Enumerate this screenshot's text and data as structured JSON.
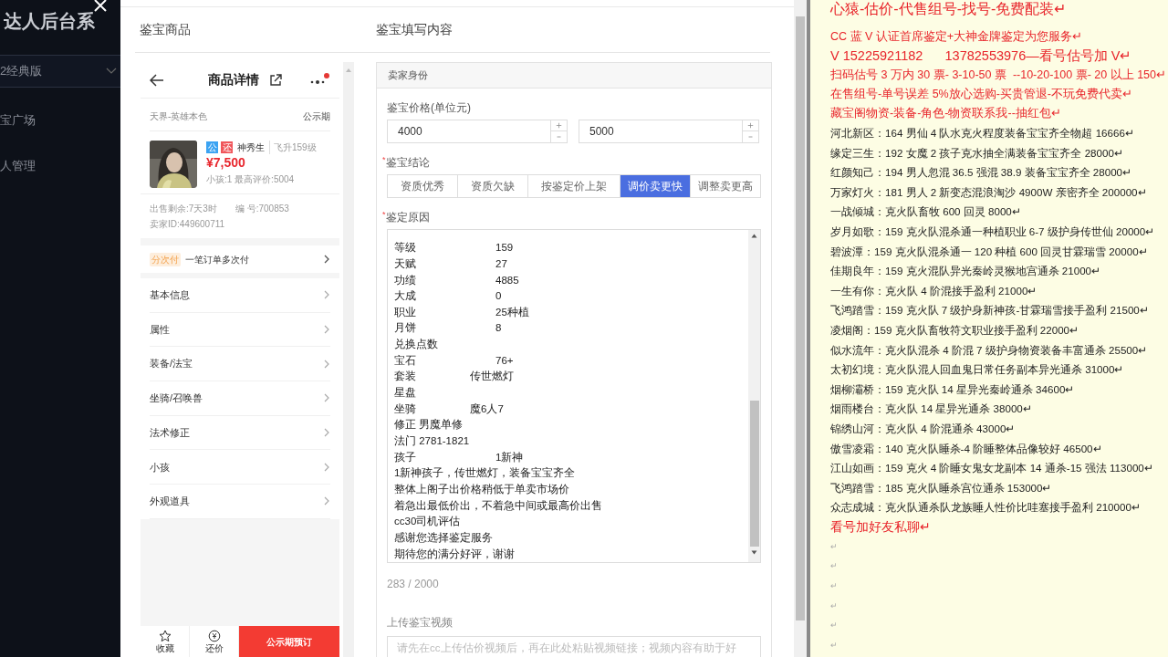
{
  "sidebar": {
    "title": "达人后台系",
    "version_select": "2经典版",
    "items": [
      {
        "label": "宝广场"
      },
      {
        "label": "人管理"
      }
    ]
  },
  "dialog": {
    "left_title": "鉴宝商品",
    "phone": {
      "title": "商品详情",
      "server": "天界-英雄本色",
      "status": "公示期",
      "tags": [
        {
          "label": "公",
          "color": "#3ba3f2"
        },
        {
          "label": "还",
          "color": "#f0555a"
        }
      ],
      "role": "神秀生",
      "level": "飞升159级",
      "price": "¥7,500",
      "info": "小孩:1 最高评价:5004",
      "remaining": "出售剩余:7天3时",
      "serial": "编 号:700853",
      "seller": "卖家ID:449600711",
      "installment_badge": "分次付",
      "installment_text": "一笔订单多次付",
      "menu": [
        "基本信息",
        "属性",
        "装备/法宝",
        "坐骑/召唤兽",
        "法术修正",
        "小孩",
        "外观道具"
      ],
      "actions": [
        {
          "kind": "star",
          "label": "收藏"
        },
        {
          "kind": "coin",
          "label": "还价"
        }
      ],
      "primary_action": "公示期预订"
    },
    "right_title": "鉴宝填写内容",
    "section_title": "卖家身份",
    "price_label": "鉴宝价格(单位元)",
    "price_min": "4000",
    "price_max": "5000",
    "conclusion": {
      "mark": "*",
      "label": "鉴宝结论"
    },
    "conclusion_options": [
      {
        "label": "资质优秀",
        "selected": false
      },
      {
        "label": "资质欠缺",
        "selected": false
      },
      {
        "label": "按鉴定价上架",
        "selected": false
      },
      {
        "label": "调价卖更快",
        "selected": true
      },
      {
        "label": "调整卖更高",
        "selected": false
      }
    ],
    "reason": {
      "mark": "*",
      "label": "鉴定原因",
      "lines": [
        {
          "kind": "pair",
          "key": "等级",
          "value": "159"
        },
        {
          "kind": "pair",
          "key": "天赋",
          "value": "27"
        },
        {
          "kind": "pair",
          "key": "功绩",
          "value": "4885"
        },
        {
          "kind": "pair",
          "key": "大成",
          "value": "0"
        },
        {
          "kind": "pair",
          "key": "职业",
          "value": "25种植"
        },
        {
          "kind": "pair",
          "key": "月饼",
          "value": "8"
        },
        {
          "kind": "text",
          "text": "兑换点数"
        },
        {
          "kind": "pair",
          "key": "宝石",
          "value": "76+"
        },
        {
          "kind": "short_pair",
          "key": "套装",
          "value": "传世燃灯"
        },
        {
          "kind": "text",
          "text": "星盘"
        },
        {
          "kind": "short_pair",
          "key": "坐骑",
          "value": "魔6人7"
        },
        {
          "kind": "text",
          "text": "修正 男魔单修"
        },
        {
          "kind": "text",
          "text": "法门 2781-1821"
        },
        {
          "kind": "pair",
          "key": "孩子",
          "value": "1新神"
        },
        {
          "kind": "text",
          "text": "1新神孩子，传世燃灯，装备宝宝齐全"
        },
        {
          "kind": "text",
          "text": "整体上阁子出价格稍低于单卖市场价"
        },
        {
          "kind": "text",
          "text": "着急出最低价出，不着急中间或最高价出售"
        },
        {
          "kind": "text",
          "text": "cc30司机评估"
        },
        {
          "kind": "text",
          "text": "感谢您选择鉴定服务"
        },
        {
          "kind": "text",
          "text": "期待您的满分好评，谢谢"
        }
      ]
    },
    "counter": "283 / 2000",
    "video_label": "上传鉴宝视频",
    "video_placeholder": "请先在cc上传估价视频后，再在此处粘贴视频链接；视频内容有助于好"
  },
  "doc": {
    "lines": [
      {
        "kind": "heading",
        "text": "心猿-估价-代售组号-找号-免费配装↵"
      },
      {
        "kind": "promo",
        "text": "CC 蓝 V 认证首席鉴定+大神金牌鉴定为您服务↵"
      },
      {
        "kind": "contact",
        "text": "V 15225921182      13782553976—看号估号加 V↵"
      },
      {
        "kind": "promo",
        "text": "扫码估号 3 万内 30 票- 3-10-50 票  --10-20-100 票- 20 以上 150↵"
      },
      {
        "kind": "promo",
        "text": "在售组号-单号误差 5%放心选购-买贵管退-不玩免费代卖↵"
      },
      {
        "kind": "promo",
        "text": "藏宝阁物资-装备-角色-物资联系我--抽红包↵"
      },
      {
        "kind": "item",
        "text": "河北新区：164 男仙 4 队水克火程度装备宝宝齐全物超 16666↵"
      },
      {
        "kind": "item",
        "text": "缘定三生：192 女魔 2 孩子克水抽全满装备宝宝齐全 28000↵"
      },
      {
        "kind": "item",
        "text": "红颜知己：194 男人忽混 36.5 强混 38.9 装备宝宝齐全 28000↵"
      },
      {
        "kind": "item",
        "text": "万家灯火：181 男人 2 新变态混浪淘沙 4900W 亲密齐全 200000↵"
      },
      {
        "kind": "item",
        "text": "一战倾城：克火队畜牧 600 回灵 8000↵"
      },
      {
        "kind": "item",
        "text": "岁月如歌：159 克火队混杀通一种植职业 6-7 级护身传世仙 20000↵"
      },
      {
        "kind": "item",
        "text": "碧波潭：159 克火队混杀通一 120 种植 600 回灵甘霖瑞雪 20000↵"
      },
      {
        "kind": "item",
        "text": "佳期良年：159 克火混队异光秦岭灵猴地宫通杀 21000↵"
      },
      {
        "kind": "item",
        "text": "一生有你：克火队 4 阶混接手盈利 21000↵"
      },
      {
        "kind": "item",
        "text": "飞鸿踏雪：159 克火队 7 级护身新神孩-甘霖瑞雪接手盈利 21500↵"
      },
      {
        "kind": "item",
        "text": "凌烟阁：159 克火队畜牧符文职业接手盈利 22000↵"
      },
      {
        "kind": "item",
        "text": "似水流年：克火队混杀 4 阶混 7 级护身物资装备丰富通杀 25500↵"
      },
      {
        "kind": "item",
        "text": "太初幻境：克火队混人回血鬼日常任务副本异光通杀 31000↵"
      },
      {
        "kind": "item",
        "text": "烟柳灞桥：159 克火队 14 星异光秦岭通杀 34600↵"
      },
      {
        "kind": "item",
        "text": "烟雨楼台：克火队 14 星异光通杀 38000↵"
      },
      {
        "kind": "item",
        "text": "锦绣山河：克火队 4 阶混通杀 43000↵"
      },
      {
        "kind": "item",
        "text": "傲雪凌霜：140 克火队睡杀-4 阶睡整体品像较好 46500↵"
      },
      {
        "kind": "item",
        "text": "江山如画：159 克火 4 阶睡女鬼女龙副本 14 通杀-15 强法 113000↵"
      },
      {
        "kind": "item",
        "text": "飞鸿踏雪：185 克火队睡杀宫位通杀 153000↵"
      },
      {
        "kind": "item",
        "text": "众志成城：克火队通杀队龙族睡人性价比哇塞接手盈利 210000↵"
      },
      {
        "kind": "closing",
        "text": "看号加好友私聊↵"
      },
      {
        "kind": "empty",
        "text": "↵"
      },
      {
        "kind": "empty",
        "text": "↵"
      },
      {
        "kind": "empty",
        "text": "↵"
      },
      {
        "kind": "empty",
        "text": "↵"
      },
      {
        "kind": "empty",
        "text": "↵"
      },
      {
        "kind": "empty",
        "text": "↵"
      }
    ]
  }
}
